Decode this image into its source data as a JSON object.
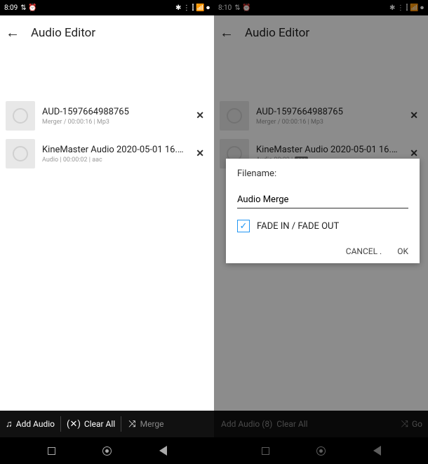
{
  "left": {
    "status": {
      "time": "8:09",
      "icons": "⇅ ⏰",
      "right": "✱ ⋮ ⫿ 📶 ⏺"
    },
    "toolbar": {
      "title": "Audio Editor"
    },
    "items": [
      {
        "title": "AUD-1597664988765",
        "meta": "Merger / 00:00:16 | Mp3"
      },
      {
        "title": "KineMaster Audio  2020-05-01 16..…",
        "meta": "Audio | 00:00:02 | aac"
      }
    ],
    "bottom": {
      "add": "Add Audio",
      "clear": "Clear All",
      "merge": "Merge"
    }
  },
  "right": {
    "status": {
      "time": "8:10",
      "icons": "⇅ ⏰",
      "right": "✱ ⋮ ⫿ 📶 ⏺"
    },
    "toolbar": {
      "title": "Audio Editor"
    },
    "items": [
      {
        "title": "AUD-1597664988765",
        "meta": "Merger / 00:00:16 | Mp3"
      },
      {
        "title": "KineMaster Audio  2020-05-01 16..…",
        "meta": "Audio 00:02 |",
        "badge": "aac"
      }
    ],
    "dialog": {
      "label": "Filename:",
      "value": "Audio Merge",
      "fade": "FADE IN / FADE OUT",
      "cancel": "CANCEL .",
      "ok": "OK"
    },
    "bottom": {
      "add": "Add Audio (8)",
      "clear": "Clear All",
      "go": "Go"
    }
  }
}
